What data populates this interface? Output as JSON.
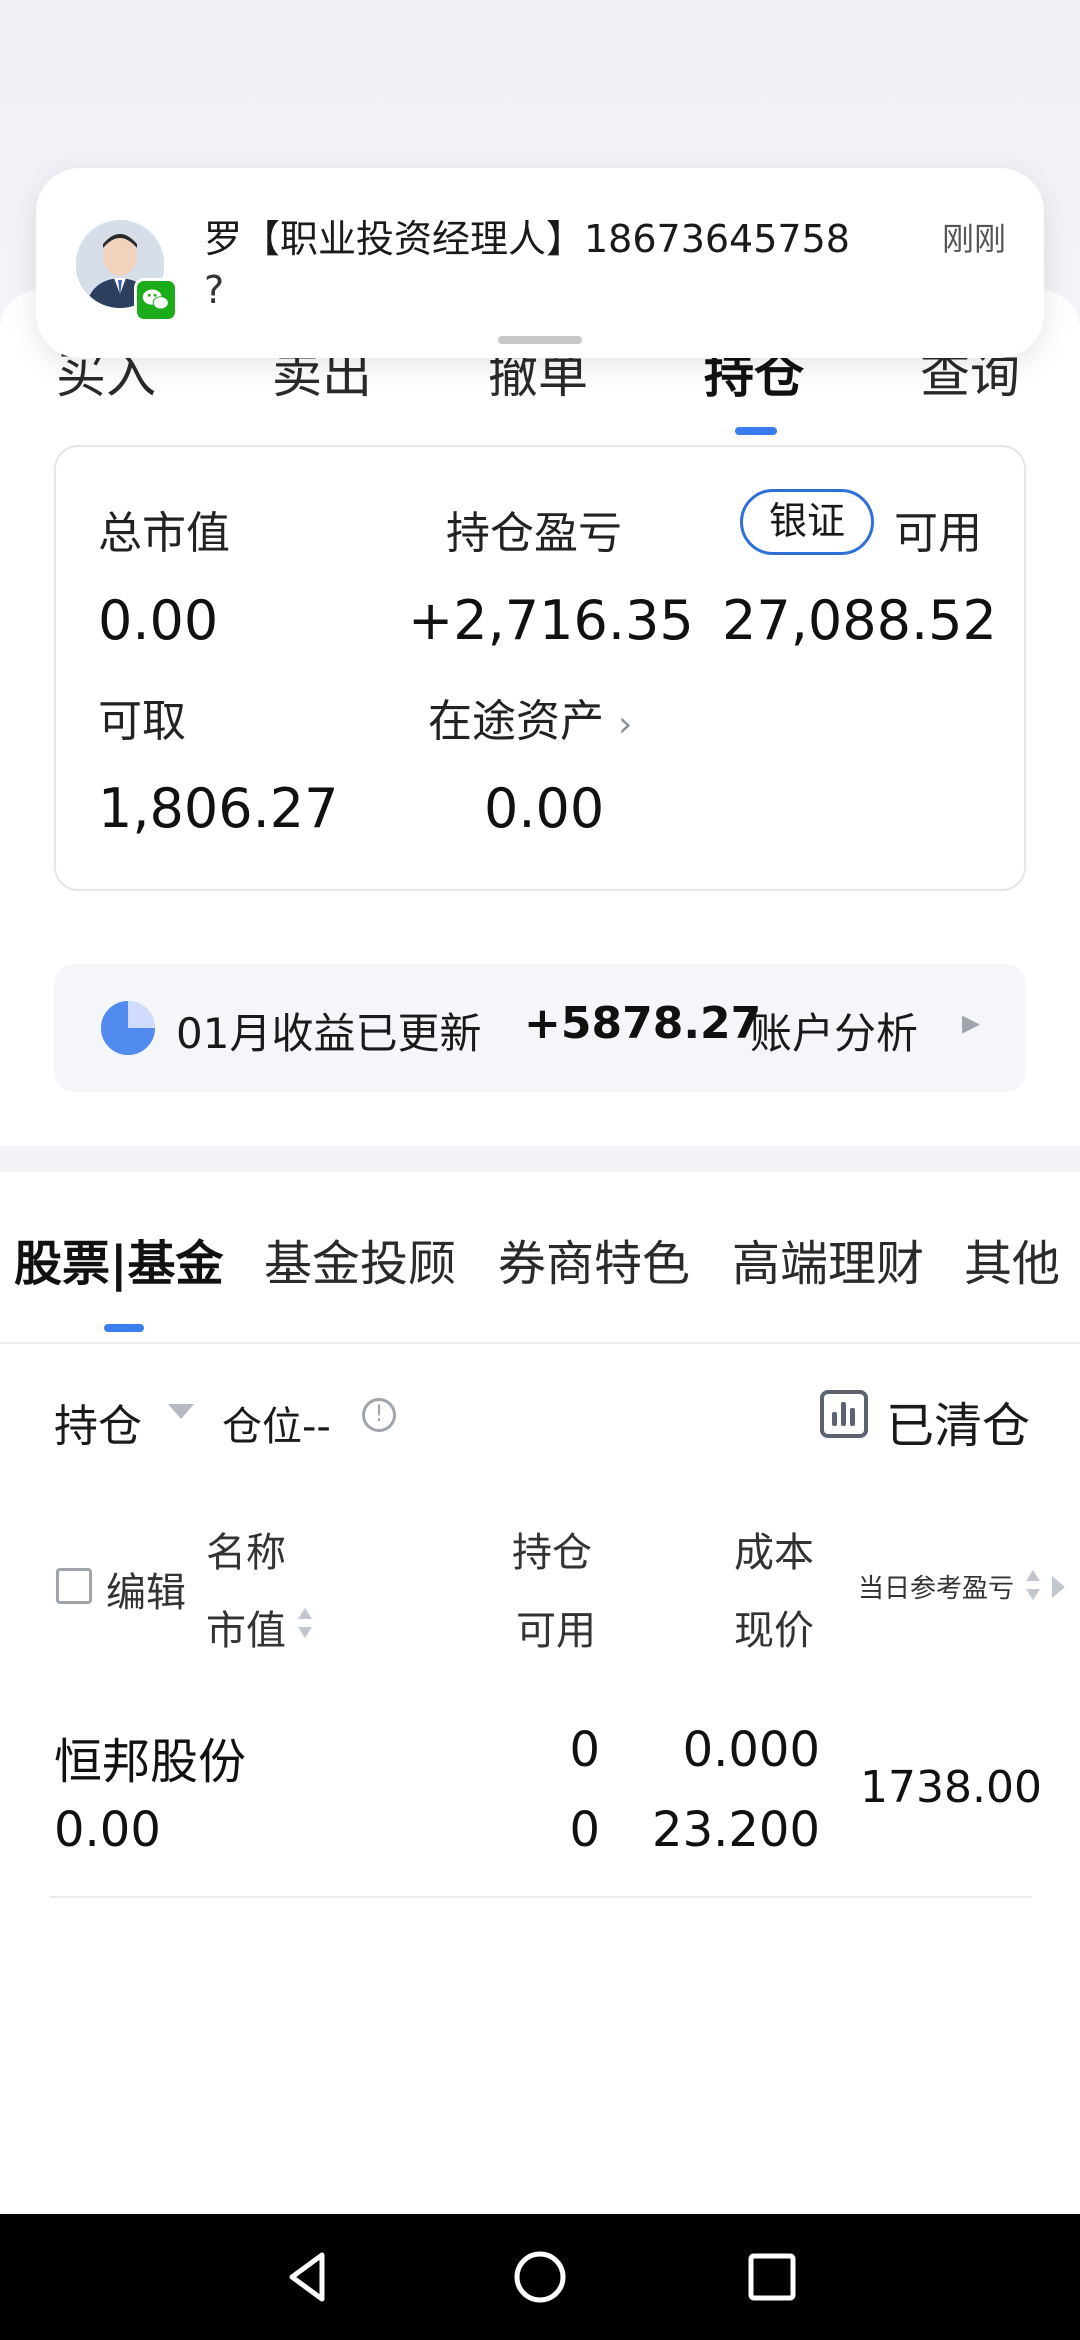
{
  "trade_tabs": [
    {
      "label": "买入",
      "active": false
    },
    {
      "label": "卖出",
      "active": false
    },
    {
      "label": "撤单",
      "active": false
    },
    {
      "label": "持仓",
      "active": true
    },
    {
      "label": "查询",
      "active": false
    }
  ],
  "notification": {
    "title": "罗【职业投资经理人】18673645758",
    "time": "刚刚",
    "body": "?"
  },
  "assets": {
    "total_value_label": "总市值",
    "total_value": "0.00",
    "position_pnl_label": "持仓盈亏",
    "position_pnl": "+2,716.35",
    "bank_transfer_label": "银证",
    "available_label": "可用",
    "available": "27,088.52",
    "withdrawable_label": "可取",
    "withdrawable": "1,806.27",
    "in_transit_label": "在途资产",
    "in_transit": "0.00"
  },
  "monthly": {
    "text": "01月收益已更新",
    "amount": "+5878.27",
    "link": "账户分析"
  },
  "category_tabs": [
    {
      "label": "股票|基金",
      "active": true
    },
    {
      "label": "基金投顾",
      "active": false
    },
    {
      "label": "券商特色",
      "active": false
    },
    {
      "label": "高端理财",
      "active": false
    },
    {
      "label": "其他",
      "active": false
    }
  ],
  "holdings": {
    "filter_label": "持仓",
    "position_label": "仓位--",
    "cleared_label": "已清仓",
    "header": {
      "edit": "编辑",
      "name": "名称",
      "market_value": "市值",
      "holding": "持仓",
      "available": "可用",
      "cost": "成本",
      "price": "现价",
      "today_pnl": "当日参考盈亏"
    },
    "rows": [
      {
        "name": "恒邦股份",
        "market_value": "0.00",
        "holding": "0",
        "available": "0",
        "cost": "0.000",
        "price": "23.200",
        "today_pnl": "1738.00"
      }
    ]
  },
  "colors": {
    "accent": "#3b7cf0",
    "bank_border": "#2f6fd8",
    "wechat": "#1aad19"
  }
}
